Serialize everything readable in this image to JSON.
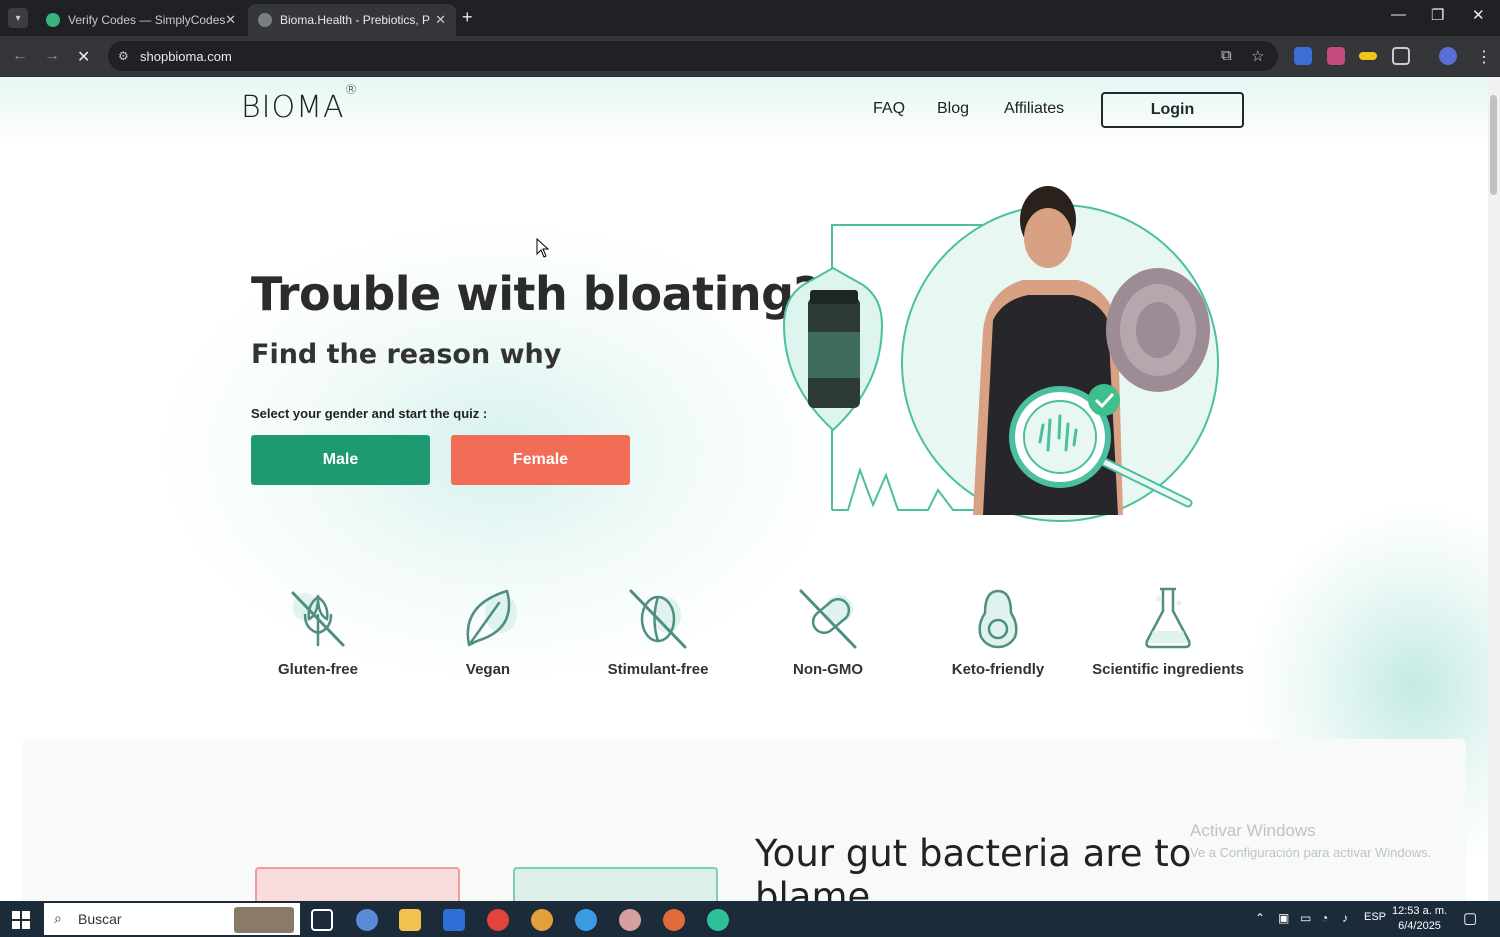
{
  "browser": {
    "tabs": [
      {
        "title": "Verify Codes — SimplyCodes",
        "active": false
      },
      {
        "title": "Bioma.Health - Prebiotics, Prob",
        "active": true
      }
    ],
    "new_tab": "+",
    "url": "shopbioma.com",
    "win": {
      "minimize": "—",
      "restore": "❐",
      "close": "✕"
    }
  },
  "site": {
    "logo": "BIOMA",
    "logo_mark": "®",
    "nav": [
      "FAQ",
      "Blog",
      "Affiliates"
    ],
    "login": "Login",
    "hero": {
      "title": "Trouble with bloating?",
      "subtitle": "Find the reason why",
      "quiz_prompt": "Select your gender and start the quiz :",
      "male": "Male",
      "female": "Female"
    },
    "features": [
      {
        "label": "Gluten-free",
        "icon": "gluten-free-icon"
      },
      {
        "label": "Vegan",
        "icon": "leaf-icon"
      },
      {
        "label": "Stimulant-free",
        "icon": "stimulant-free-icon"
      },
      {
        "label": "Non-GMO",
        "icon": "non-gmo-icon"
      },
      {
        "label": "Keto-friendly",
        "icon": "avocado-icon"
      },
      {
        "label": "Scientific ingredients",
        "icon": "flask-icon"
      }
    ],
    "section2_title": "Your gut bacteria are to blame"
  },
  "watermark": {
    "line1": "Activar Windows",
    "line2": "Ve a Configuración para activar Windows."
  },
  "taskbar": {
    "search_placeholder": "Buscar",
    "lang": "ESP",
    "time": "12:53 a. m.",
    "date": "6/4/2025"
  },
  "colors": {
    "male": "#1e9a72",
    "female": "#f26d55",
    "accent": "#4bbf9f"
  }
}
